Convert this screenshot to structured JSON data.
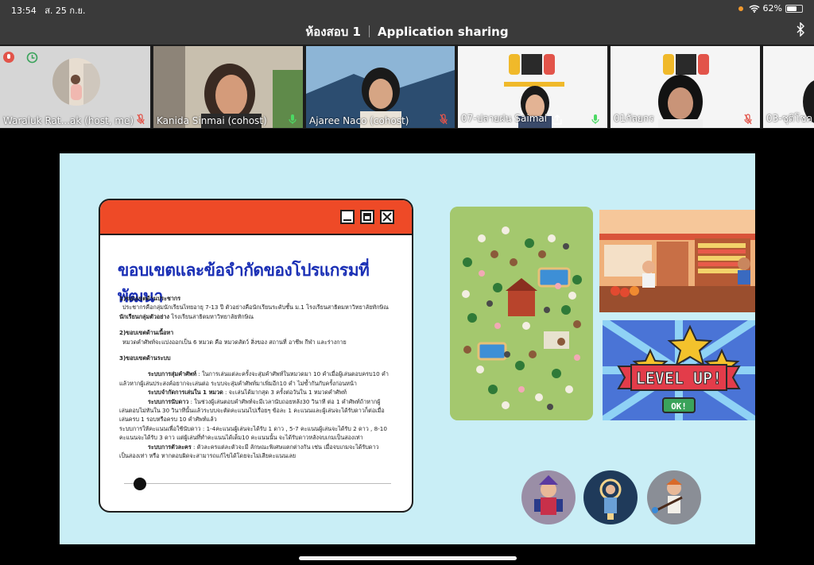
{
  "status_bar": {
    "time": "13:54",
    "date": "ส. 25 ก.ย.",
    "battery": "62%"
  },
  "title_bar": {
    "room": "ห้องสอบ 1",
    "mode": "Application sharing"
  },
  "participants": [
    {
      "name": "Waraluk Rat...ak (host, me)"
    },
    {
      "name": "Kanida Sinmai (cohost)"
    },
    {
      "name": "Ajaree Naco (cohost)"
    },
    {
      "name": "07-ปลายฝน Saimai"
    },
    {
      "name": "01กัลยกร"
    },
    {
      "name": "03-ชุติโชค"
    }
  ],
  "slide": {
    "title": "ขอบเขตและข้อจำกัดของโปรแกรมที่พัฒนา",
    "s1_head": "1)ขอบเขตด้านประชากร",
    "s1_l1": "ประชากรคือกลุ่มนักเรียนไทยอายุ 7-13 ปี ตัวอย่างคือนักเรียนระดับชั้น ม.1 โรงเรียนสาธิตมหาวิทยาลัยทักษิณ",
    "s1_l2_bold": "นักเรียนกลุ่มตัวอย่าง",
    "s1_l2": " โรงเรียนสาธิตมหาวิทยาลัยทักษิณ",
    "s2_head": "2)ขอบเขตด้านเนื้อหา",
    "s2_l1": "หมวดคำศัพท์จะแบ่งออกเป็น 6 หมวด คือ หมวดสัตว์ สิ่งของ สถานที่ อาชีพ กีฬา และร่างกาย",
    "s3_head": "3)ขอบเขตด้านระบบ",
    "r1_bold": "ระบบการสุ่มคำศัพท์",
    "r1": " : ในการเล่นแต่ละครั้งจะสุ่มคำศัพท์ในหมวดมา 10 คำเมื่อผู้เล่นตอบครบ10 คำ",
    "r1b": "แล้วหากผู้เล่นประสงค์อยากจะเล่นต่อ ระบบจะสุ่มคำศัพท์มาเพิ่มอีก10 คำ ไม่ซ้ำกันกับครั้งก่อนหน้า",
    "r2_bold": "ระบบจำกัดการเล่นใน 1 หมวด",
    "r2": " : จะเล่นได้มากสุด 3 ครั้งต่อวันใน 1 หมวดคำศัพท์",
    "r3_bold": "ระบบการนับดาว",
    "r3": " : ในช่วงผู้เล่นตอบคำศัพท์จะมีเวลานับถอยหลัง30 วินาที ต่อ 1 คำศัพท์ถ้าหากผู้",
    "r3b": "เล่นตอบไม่ทันใน 30 วินาทีนั้นแล้วระบบจะตัดคะแนนไปเรื่อยๆ ข้อละ 1 คะแนนและผู้เล่นจะได้รับดาวก็ต่อเมื่อ",
    "r3c": "เล่นครบ 1 รอบหรือครบ 10 คำศัพท์แล้ว",
    "r4": "ระบบการให้คะแนนเพื่อใช้นับดาว : 1-4คะแนนผู้เล่นจะได้รับ 1 ดาว , 5-7 คะแนนผู้เล่นจะได้รับ 2 ดาว , 8-10",
    "r4b": "คะแนนจะได้รับ 3 ดาว แต่ผู้เล่นที่ทำคะแนนได้เต็ม10 คะแนนนั้น จะได้รับดาวหลังจบเกมเป็นสองเท่า",
    "r5_bold": "ระบบการตัวละคร",
    "r5": " : ตัวละครแต่ละตัวจะมี ลักษณะพิเศษแตกต่างกัน เช่น เมื่อจบเกมจะได้รับดาว",
    "r5b": "เป็นสองเท่า หรือ หากตอบผิดจะสามารถแก้ไขได้โดยจะไม่เสียคะแนนเลย",
    "level_text": "LEVEL UP!",
    "ok_text": "OK!"
  },
  "colors": {
    "slide_bg": "#c9eef6",
    "window_header": "#ee4a27",
    "title_blue": "#1a2fb5",
    "mic_muted": "#e2544a",
    "mic_active": "#4cd964"
  }
}
